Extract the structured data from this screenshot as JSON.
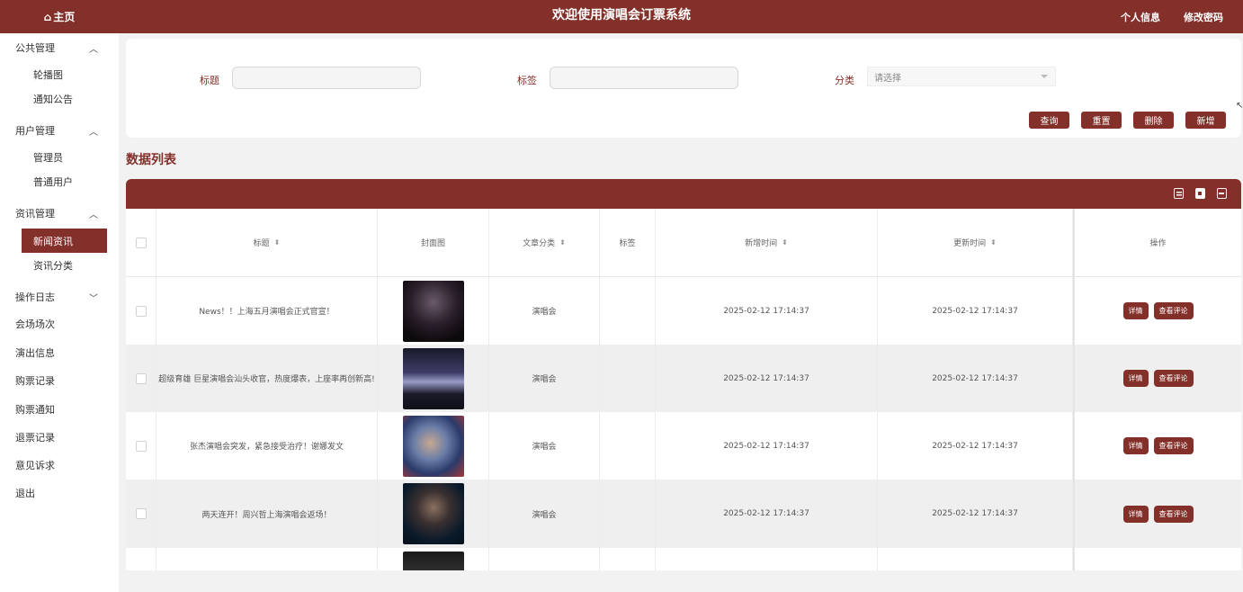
{
  "header": {
    "home_label": "主页",
    "title": "欢迎使用演唱会订票系统",
    "profile_label": "个人信息",
    "password_label": "修改密码"
  },
  "sidebar": {
    "groups": [
      {
        "label": "公共管理",
        "chevron": "^"
      },
      {
        "label": "用户管理",
        "chevron": "^"
      },
      {
        "label": "资讯管理",
        "chevron": "^"
      },
      {
        "label": "操作日志",
        "chevron": "v"
      }
    ],
    "subitems": [
      "轮播图",
      "通知公告",
      "管理员",
      "普通用户",
      "新闻资讯",
      "资讯分类"
    ],
    "items": [
      "会场场次",
      "演出信息",
      "购票记录",
      "购票通知",
      "退票记录",
      "意见诉求",
      "退出"
    ]
  },
  "search": {
    "title_label": "标题",
    "tag_label": "标签",
    "category_label": "分类",
    "category_placeholder": "请选择",
    "buttons": {
      "query": "查询",
      "reset": "重置",
      "delete": "删除",
      "add": "新增"
    }
  },
  "section_title": "数据列表",
  "table": {
    "columns": [
      "标题",
      "封面图",
      "文章分类",
      "标签",
      "新增时间",
      "更新时间",
      "操作"
    ],
    "rows": [
      {
        "title": "News！！上海五月演唱会正式官宣！",
        "category": "演唱会",
        "tag": "",
        "created": "2025-02-12 17:14:37",
        "updated": "2025-02-12 17:14:37"
      },
      {
        "title": "超级育雄 巨星演唱会汕头收官，热度爆表，上座率再创新高!",
        "category": "演唱会",
        "tag": "",
        "created": "2025-02-12 17:14:37",
        "updated": "2025-02-12 17:14:37"
      },
      {
        "title": "张杰演唱会突发，紧急接受治疗！谢娜发文",
        "category": "演唱会",
        "tag": "",
        "created": "2025-02-12 17:14:37",
        "updated": "2025-02-12 17:14:37"
      },
      {
        "title": "两天连开！周兴哲上海演唱会返场！",
        "category": "演唱会",
        "tag": "",
        "created": "2025-02-12 17:14:37",
        "updated": "2025-02-12 17:14:37"
      }
    ],
    "detail_label": "详情",
    "comments_label": "查看评论"
  },
  "colors": {
    "brand": "#84302a",
    "page_bg": "#f2f2f2",
    "stripe": "#efefef"
  }
}
